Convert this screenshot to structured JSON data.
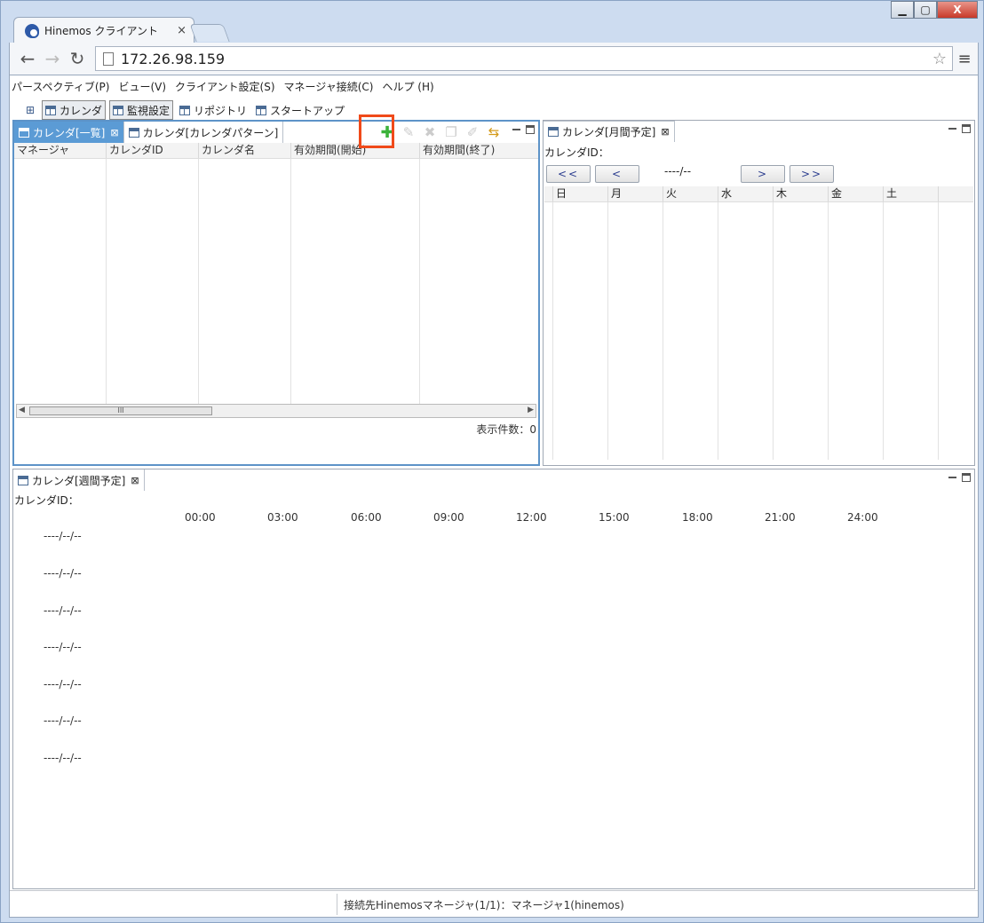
{
  "browser": {
    "tab_title": "Hinemos クライアント",
    "tab_close": "×",
    "url": "172.26.98.159",
    "win_min": "▁",
    "win_max": "▢",
    "win_close": "X"
  },
  "menubar": [
    "パースペクティブ(P)",
    "ビュー(V)",
    "クライアント設定(S)",
    "マネージャ接続(C)",
    "ヘルプ (H)"
  ],
  "perspectives": {
    "calendar": "カレンダ",
    "monitor": "監視設定",
    "repository": "リポジトリ",
    "startup": "スタートアップ"
  },
  "calendar_list": {
    "tab_active": "カレンダ[一覧]",
    "tab_pattern": "カレンダ[カレンダパターン]",
    "columns": [
      "マネージャ",
      "カレンダID",
      "カレンダ名",
      "有効期間(開始)",
      "有効期間(終了)"
    ],
    "count_label": "表示件数：0",
    "scroll_thumb": "III"
  },
  "monthly": {
    "tab": "カレンダ[月間予定]",
    "calendar_id_label": "カレンダID：",
    "nav_first": "<<",
    "nav_prev": "<",
    "month_display": "----/--",
    "nav_next": ">",
    "nav_last": ">>",
    "weekdays": [
      "日",
      "月",
      "火",
      "水",
      "木",
      "金",
      "土"
    ]
  },
  "weekly": {
    "tab": "カレンダ[週間予定]",
    "calendar_id_label": "カレンダID：",
    "times": [
      "00:00",
      "03:00",
      "06:00",
      "09:00",
      "12:00",
      "15:00",
      "18:00",
      "21:00",
      "24:00"
    ],
    "dates": [
      "----/--/--",
      "----/--/--",
      "----/--/--",
      "----/--/--",
      "----/--/--",
      "----/--/--",
      "----/--/--"
    ]
  },
  "status_bar": "接続先Hinemosマネージャ(1/1)：マネージャ1(hinemos)",
  "colors": {
    "focus_tab": "#5b9bd5",
    "highlight": "#f04a1a",
    "add_icon": "#3bb23a"
  }
}
